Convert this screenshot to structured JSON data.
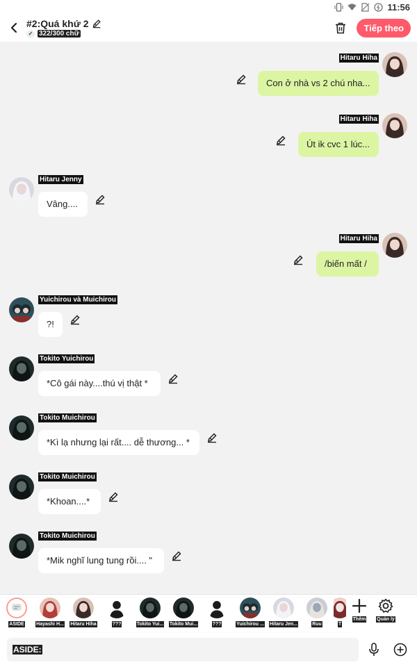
{
  "status": {
    "time": "11:56"
  },
  "header": {
    "title": "#2:Quá khứ 2",
    "word_count": "322/300 chữ",
    "next_label": "Tiếp theo"
  },
  "messages": [
    {
      "side": "right",
      "name": "Hitaru Hiha",
      "text": "Con ở nhà vs 2 chú nha...",
      "avatar": "girl-dark-hair"
    },
    {
      "side": "right",
      "name": "Hitaru Hiha",
      "text": "Út ik cvc 1 lúc...",
      "avatar": "girl-dark-hair"
    },
    {
      "side": "left",
      "name": "Hitaru Jenny",
      "text": "Vâng....",
      "avatar": "girl-white-hair"
    },
    {
      "side": "right",
      "name": "Hitaru Hiha",
      "text": "/biến mất /",
      "avatar": "girl-dark-hair"
    },
    {
      "side": "left",
      "name": "Yuichirou và Muichirou",
      "text": "?!",
      "avatar": "twins"
    },
    {
      "side": "left",
      "name": "Tokito Yuichirou",
      "text": "*Cô gái này....thú vị thật *",
      "avatar": "boy-dark"
    },
    {
      "side": "left",
      "name": "Tokito Muichirou",
      "text": "*Kì lạ nhưng lại rất.... dễ thương... *",
      "avatar": "boy-dark"
    },
    {
      "side": "left",
      "name": "Tokito Muichirou",
      "text": "*Khoan....*",
      "avatar": "boy-dark"
    },
    {
      "side": "left",
      "name": "Tokito Muichirou",
      "text": "*Mik nghĩ lung tung rồi.... \"",
      "avatar": "boy-dark"
    }
  ],
  "characters": [
    {
      "name": "ASIDE",
      "avatar": "aside-icon"
    },
    {
      "name": "Hayashi H...",
      "avatar": "red-hair"
    },
    {
      "name": "Hitaru Hiha",
      "avatar": "girl-dark-hair"
    },
    {
      "name": "???",
      "avatar": "silhouette"
    },
    {
      "name": "Tokito Yui...",
      "avatar": "boy-dark"
    },
    {
      "name": "Tokito Mui...",
      "avatar": "boy-dark"
    },
    {
      "name": "???",
      "avatar": "silhouette"
    },
    {
      "name": "Yuichirou ...",
      "avatar": "twins"
    },
    {
      "name": "Hitaru Jen...",
      "avatar": "girl-white-hair"
    },
    {
      "name": "Ruu",
      "avatar": "pale"
    },
    {
      "name": "T",
      "avatar": "partial"
    }
  ],
  "tools": {
    "add_label": "Thêm",
    "manage_label": "Quản lý"
  },
  "input": {
    "prefix": "ASIDE:"
  },
  "colors": {
    "accent": "#ff5a6b",
    "bubble_right": "#dcf5a3",
    "bubble_left": "#ffffff",
    "background": "#f2f2f2"
  }
}
